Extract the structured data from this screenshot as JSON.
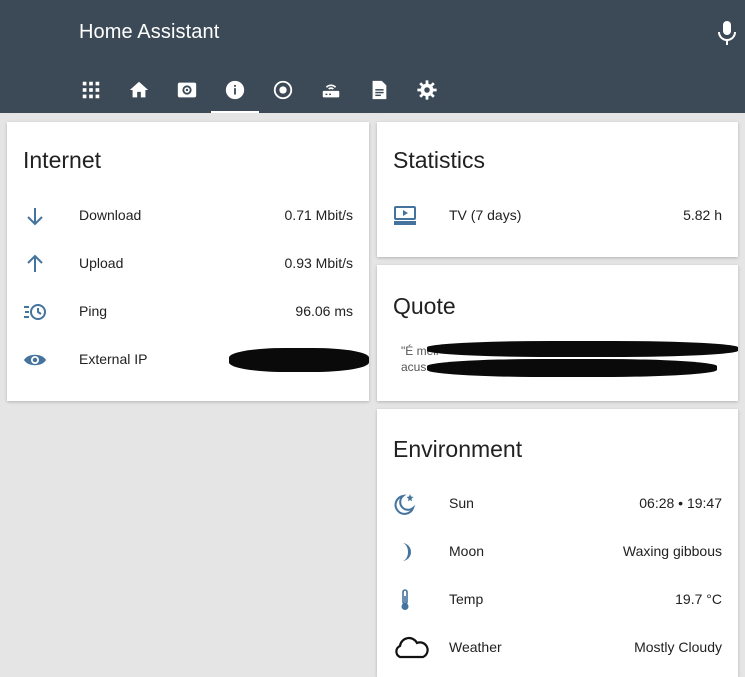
{
  "header": {
    "title": "Home Assistant",
    "mic_icon": "microphone-icon",
    "tabs": [
      {
        "icon": "apps-grid-icon",
        "active": false
      },
      {
        "icon": "home-icon",
        "active": false
      },
      {
        "icon": "speaker-icon",
        "active": false
      },
      {
        "icon": "info-icon",
        "active": true
      },
      {
        "icon": "record-icon",
        "active": false
      },
      {
        "icon": "router-icon",
        "active": false
      },
      {
        "icon": "document-icon",
        "active": false
      },
      {
        "icon": "settings-icon",
        "active": false
      }
    ]
  },
  "internet": {
    "title": "Internet",
    "rows": [
      {
        "icon": "arrow-down-icon",
        "label": "Download",
        "value": "0.71 Mbit/s"
      },
      {
        "icon": "arrow-up-icon",
        "label": "Upload",
        "value": "0.93 Mbit/s"
      },
      {
        "icon": "timer-icon",
        "label": "Ping",
        "value": "96.06 ms"
      },
      {
        "icon": "eye-icon",
        "label": "External IP",
        "value": ""
      }
    ]
  },
  "statistics": {
    "title": "Statistics",
    "rows": [
      {
        "icon": "tv-icon",
        "label": "TV (7 days)",
        "value": "5.82 h"
      }
    ]
  },
  "quote": {
    "title": "Quote",
    "text_start": "\"É mell",
    "text_line2": "acus"
  },
  "environment": {
    "title": "Environment",
    "rows": [
      {
        "icon": "sun-moon-icon",
        "label": "Sun",
        "value": "06:28 • 19:47"
      },
      {
        "icon": "moon-crescent-icon",
        "label": "Moon",
        "value": "Waxing gibbous"
      },
      {
        "icon": "thermometer-icon",
        "label": "Temp",
        "value": "19.7 °C"
      },
      {
        "icon": "cloud-icon",
        "label": "Weather",
        "value": "Mostly Cloudy"
      }
    ]
  },
  "colors": {
    "header_bg": "#3b4a56",
    "icon_blue": "#44739e",
    "page_bg": "#e5e5e5"
  }
}
